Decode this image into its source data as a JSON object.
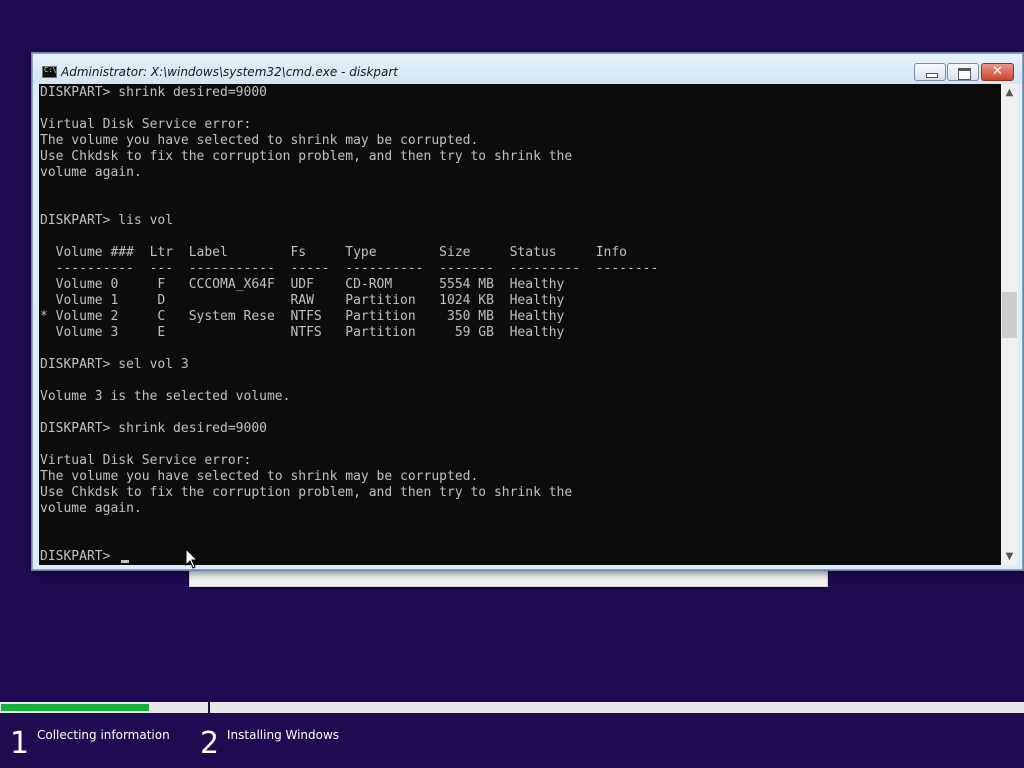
{
  "window": {
    "title": "Administrator: X:\\windows\\system32\\cmd.exe - diskpart",
    "buttons": {
      "minimize": "minimize",
      "maximize": "maximize",
      "close": "✕"
    }
  },
  "console": {
    "lines": [
      "DISKPART> shrink desired=9000",
      "",
      "Virtual Disk Service error:",
      "The volume you have selected to shrink may be corrupted.",
      "Use Chkdsk to fix the corruption problem, and then try to shrink the",
      "volume again.",
      "",
      "",
      "DISKPART> lis vol",
      "",
      "  Volume ###  Ltr  Label        Fs     Type        Size     Status     Info",
      "  ----------  ---  -----------  -----  ----------  -------  ---------  --------",
      "  Volume 0     F   CCCOMA_X64F  UDF    CD-ROM      5554 MB  Healthy",
      "  Volume 1     D                RAW    Partition   1024 KB  Healthy",
      "* Volume 2     C   System Rese  NTFS   Partition    350 MB  Healthy",
      "  Volume 3     E                NTFS   Partition     59 GB  Healthy",
      "",
      "DISKPART> sel vol 3",
      "",
      "Volume 3 is the selected volume.",
      "",
      "DISKPART> shrink desired=9000",
      "",
      "Virtual Disk Service error:",
      "The volume you have selected to shrink may be corrupted.",
      "Use Chkdsk to fix the corruption problem, and then try to shrink the",
      "volume again.",
      "",
      "",
      "DISKPART> "
    ]
  },
  "progress": {
    "fraction": 0.145,
    "steps": [
      {
        "number": "1",
        "label": "Collecting information"
      },
      {
        "number": "2",
        "label": "Installing Windows"
      }
    ]
  },
  "colors": {
    "desktop_bg": "#200a52",
    "progress_green": "#16b03c",
    "console_bg": "#0c0c0c",
    "console_fg": "#c0c0c0"
  }
}
